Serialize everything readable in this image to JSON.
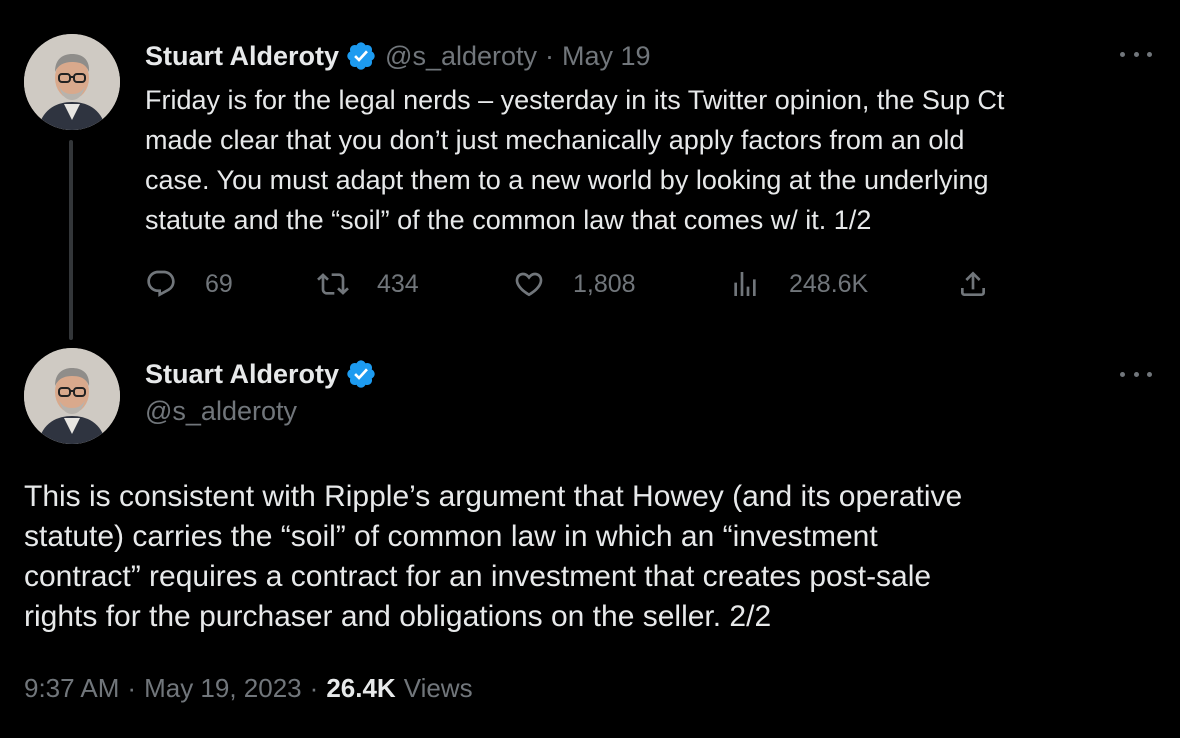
{
  "colors": {
    "background": "#000000",
    "text_primary": "#e7e9ea",
    "text_secondary": "#71767b",
    "verified_badge": "#1d9bf0"
  },
  "tweet1": {
    "author_name": "Stuart Alderoty",
    "handle": "@s_alderoty",
    "separator": "·",
    "date": "May 19",
    "text": "Friday is for the legal nerds – yesterday in its Twitter opinion, the Sup Ct\nmade clear that you don’t just mechanically apply factors from an old\ncase. You must adapt them to a new world by looking at the underlying\nstatute and the “soil” of the common law that comes w/ it. 1/2",
    "actions": {
      "reply_icon": "reply-icon",
      "reply_count": "69",
      "retweet_icon": "retweet-icon",
      "retweet_count": "434",
      "like_icon": "heart-icon",
      "like_count": "1,808",
      "views_icon": "views-chart-icon",
      "views_count": "248.6K",
      "share_icon": "share-icon"
    }
  },
  "tweet2": {
    "author_name": "Stuart Alderoty",
    "handle": "@s_alderoty",
    "text": "This is consistent with Ripple’s argument that Howey (and its operative\nstatute) carries the “soil” of common law in which an “investment\ncontract” requires a contract for an investment that creates post-sale\nrights for the purchaser and obligations on the seller. 2/2",
    "time": "9:37 AM",
    "separator": "·",
    "full_date": "May 19, 2023",
    "views_count": "26.4K",
    "views_label": "Views"
  }
}
